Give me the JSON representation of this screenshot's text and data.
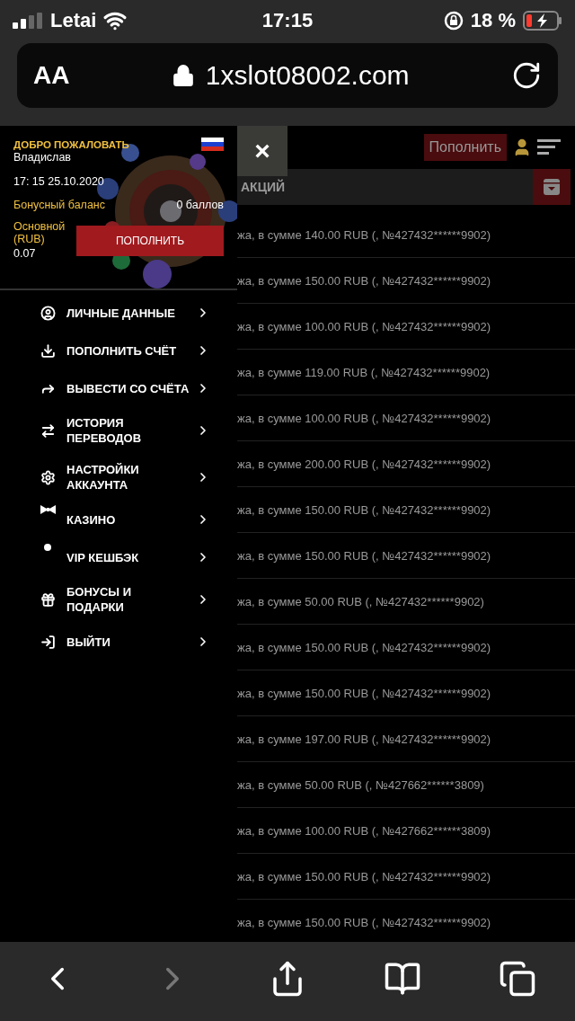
{
  "status_bar": {
    "carrier": "Letai",
    "time": "17:15",
    "battery": "18 %"
  },
  "browser": {
    "text_size_button": "AA",
    "url": "1xslot08002.com"
  },
  "drawer": {
    "welcome": "ДОБРО ПОЖАЛОВАТЬ",
    "user_name": "Владислав",
    "datetime": "17: 15 25.10.2020",
    "bonus_label": "Бонусный баланс",
    "bonus_value": "0 баллов",
    "main_label": "Основной (RUB)",
    "main_value": "0.07",
    "deposit_button": "ПОПОЛНИТЬ",
    "menu": [
      {
        "kind": "user",
        "label": "ЛИЧНЫЕ ДАННЫЕ"
      },
      {
        "kind": "deposit",
        "label": "ПОПОЛНИТЬ СЧЁТ"
      },
      {
        "kind": "withdraw",
        "label": "ВЫВЕСТИ СО СЧЁТА"
      },
      {
        "kind": "history",
        "label": "ИСТОРИЯ ПЕРЕВОДОВ",
        "two_line": true
      },
      {
        "kind": "settings",
        "label": "НАСТРОЙКИ АККАУНТА",
        "two_line": true
      },
      {
        "kind": "casino",
        "label": "КАЗИНО"
      },
      {
        "kind": "dot",
        "label": "VIP КЕШБЭК"
      },
      {
        "kind": "gift",
        "label": "БОНУСЫ И ПОДАРКИ",
        "two_line": true
      },
      {
        "kind": "logout",
        "label": "ВЫЙТИ"
      }
    ]
  },
  "page": {
    "close_button": "×",
    "deposit_button": "Пополнить",
    "section_title": "АКЦИЙ",
    "rows": [
      "жа, в сумме 140.00 RUB (, №427432******9902)",
      "жа, в сумме 150.00 RUB (, №427432******9902)",
      "жа, в сумме 100.00 RUB (, №427432******9902)",
      "жа, в сумме 119.00 RUB (, №427432******9902)",
      "жа, в сумме 100.00 RUB (, №427432******9902)",
      "жа, в сумме 200.00 RUB (, №427432******9902)",
      "жа, в сумме 150.00 RUB (, №427432******9902)",
      "жа, в сумме 150.00 RUB (, №427432******9902)",
      "жа, в сумме 50.00 RUB (, №427432******9902)",
      "жа, в сумме 150.00 RUB (, №427432******9902)",
      "жа, в сумме 150.00 RUB (, №427432******9902)",
      "жа, в сумме 197.00 RUB (, №427432******9902)",
      "жа, в сумме 50.00 RUB (, №427662******3809)",
      "жа, в сумме 100.00 RUB (, №427662******3809)",
      "жа, в сумме 150.00 RUB (, №427432******9902)",
      "жа, в сумме 150.00 RUB (, №427432******9902)"
    ]
  },
  "toolbar": [
    {
      "kind": "back",
      "disabled": false
    },
    {
      "kind": "forward",
      "disabled": true
    },
    {
      "kind": "share",
      "disabled": false
    },
    {
      "kind": "bookmarks",
      "disabled": false
    },
    {
      "kind": "tabs",
      "disabled": false
    }
  ]
}
